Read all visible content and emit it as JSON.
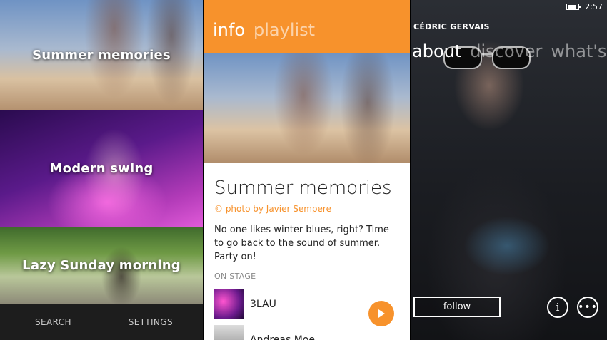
{
  "playlists": {
    "tiles": [
      {
        "label": "Summer memories"
      },
      {
        "label": "Modern swing"
      },
      {
        "label": "Lazy Sunday morning"
      }
    ],
    "appbar": {
      "search": "SEARCH",
      "settings": "SETTINGS"
    }
  },
  "info_view": {
    "pivots": {
      "active": "info",
      "inactive": "playlist"
    },
    "title": "Summer memories",
    "credit": "© photo by Javier Sempere",
    "description": "No one likes winter blues, right? Time to go back to the sound of summer. Party on!",
    "section_label": "ON STAGE",
    "artists": [
      {
        "name": "3LAU"
      },
      {
        "name": "Andreas Moe"
      }
    ],
    "accent_color": "#f7922c"
  },
  "artist_view": {
    "status": {
      "time": "2:57"
    },
    "artist_name": "CÉDRIC GERVAIS",
    "pivots": {
      "active": "about",
      "second": "discover",
      "third": "what's n"
    },
    "follow_label": "follow",
    "icons": {
      "info": "info-icon",
      "more": "more-icon",
      "battery": "battery-icon",
      "play": "play-icon"
    }
  }
}
